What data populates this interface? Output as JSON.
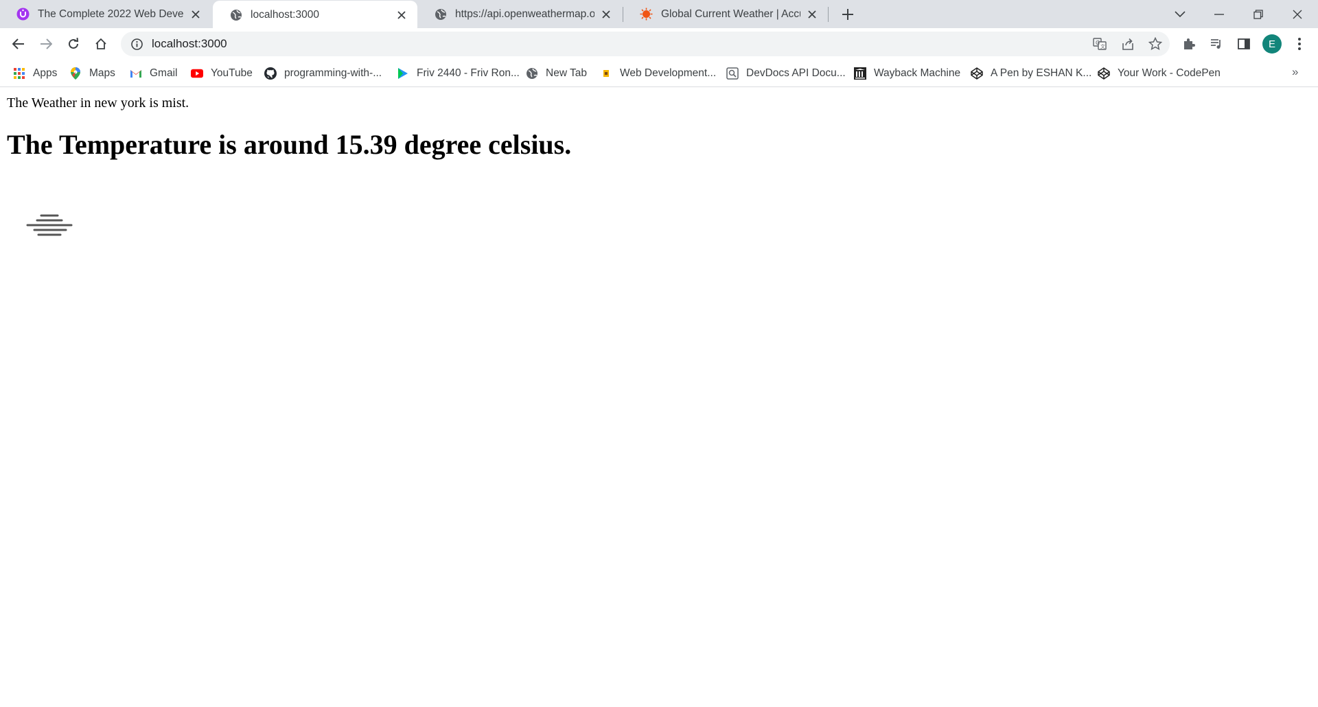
{
  "browser": {
    "tabs": [
      {
        "title": "The Complete 2022 Web Develop",
        "favicon": "udemy-icon",
        "active": false
      },
      {
        "title": "localhost:3000",
        "favicon": "globe-icon",
        "active": true
      },
      {
        "title": "https://api.openweathermap.org/",
        "favicon": "globe-icon",
        "active": false
      },
      {
        "title": "Global Current Weather | AccuWe",
        "favicon": "accuweather-icon",
        "active": false
      }
    ],
    "address_bar": {
      "url": "localhost:3000"
    },
    "profile_initial": "E",
    "accent_color": "#12857a"
  },
  "bookmarks": [
    {
      "label": "Apps",
      "icon": "apps-grid-icon"
    },
    {
      "label": "Maps",
      "icon": "maps-pin-icon"
    },
    {
      "label": "Gmail",
      "icon": "gmail-icon"
    },
    {
      "label": "YouTube",
      "icon": "youtube-icon"
    },
    {
      "label": "programming-with-...",
      "icon": "github-icon"
    },
    {
      "label": "Friv 2440 - Friv Ron...",
      "icon": "play-icon"
    },
    {
      "label": "New Tab",
      "icon": "globe-icon"
    },
    {
      "label": "Web Development...",
      "icon": "bookmark-icon"
    },
    {
      "label": "DevDocs API Docu...",
      "icon": "devdocs-icon"
    },
    {
      "label": "Wayback Machine",
      "icon": "wayback-icon"
    },
    {
      "label": "A Pen by ESHAN K...",
      "icon": "codepen-icon"
    },
    {
      "label": "Your Work - CodePen",
      "icon": "codepen-icon"
    }
  ],
  "page": {
    "description_line": "The Weather in new york is mist.",
    "temperature_heading": "The Temperature is around 15.39 degree celsius.",
    "weather_icon": "mist-icon"
  }
}
